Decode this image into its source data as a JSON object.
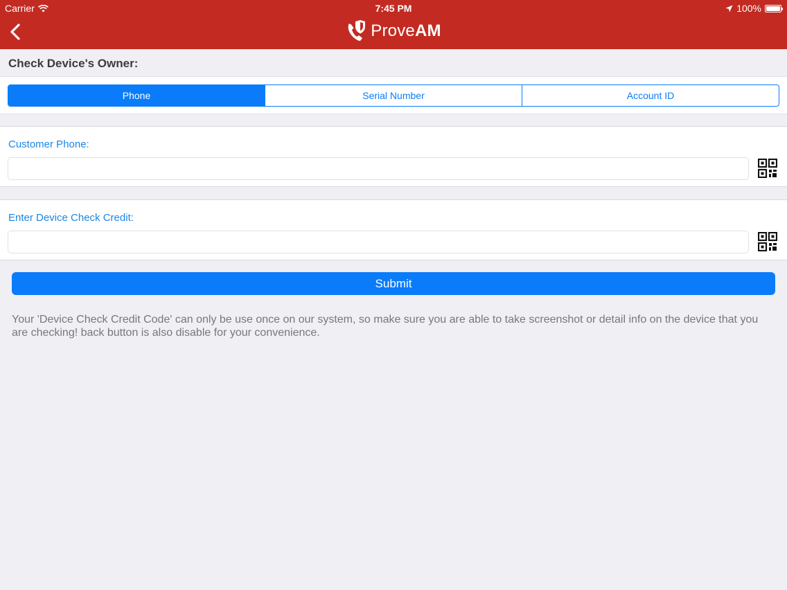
{
  "status_bar": {
    "carrier": "Carrier",
    "time": "7:45 PM",
    "battery": "100%",
    "icons": [
      "wifi-icon",
      "location-arrow-icon",
      "battery-icon"
    ]
  },
  "nav": {
    "logo_text_prefix": "Prove",
    "logo_text_suffix": "AM",
    "back_icon": "chevron-left-icon",
    "bar_color": "#c32b22"
  },
  "page": {
    "title": "Check Device's Owner:"
  },
  "segments": {
    "items": [
      {
        "label": "Phone",
        "selected": true
      },
      {
        "label": "Serial Number",
        "selected": false
      },
      {
        "label": "Account ID",
        "selected": false
      }
    ],
    "accent": "#0a7cfa"
  },
  "form": {
    "customer_phone": {
      "label": "Customer Phone:",
      "value": "",
      "scan_icon": "qr-code-icon"
    },
    "credit": {
      "label": "Enter Device Check Credit:",
      "value": "",
      "scan_icon": "qr-code-icon"
    }
  },
  "submit": {
    "label": "Submit"
  },
  "note": "Your 'Device Check Credit Code' can only be use once on our system, so make sure you are able to take screenshot or detail info on the device that you are checking! back button is also disable for your convenience."
}
